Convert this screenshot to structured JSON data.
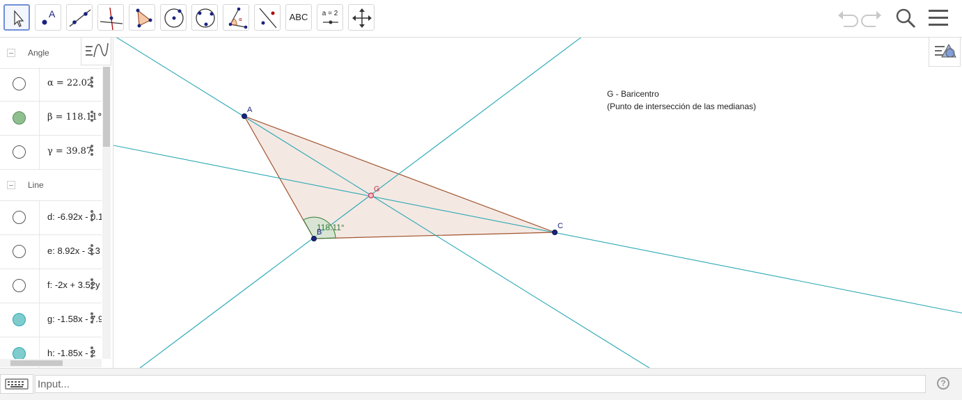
{
  "toolbar": {
    "text_tool_label": "ABC",
    "slider_tool_label": "a = 2"
  },
  "algebra": {
    "sections": [
      {
        "title": "Angle"
      },
      {
        "title": "Line"
      }
    ],
    "angle_items": [
      {
        "name": "α",
        "value": "= 22.02",
        "color": "#ffffff"
      },
      {
        "name": "β",
        "value": "= 118.11°",
        "color": "#8fbf8f"
      },
      {
        "name": "γ",
        "value": "= 39.87",
        "color": "#ffffff"
      }
    ],
    "line_items": [
      {
        "text": "d: -6.92x - 0.1",
        "color": "#ffffff"
      },
      {
        "text": "e: 8.92x - 3.3",
        "color": "#ffffff"
      },
      {
        "text": "f: -2x + 3.52y",
        "color": "#ffffff"
      },
      {
        "text": "g: -1.58x - 7.9",
        "color": "#7fcccc"
      },
      {
        "text": "h: -1.85x - 2",
        "color": "#7fcccc"
      }
    ]
  },
  "graphics": {
    "points": {
      "A": "A",
      "B": "B",
      "C": "C",
      "G": "G"
    },
    "angle_label": "118.11°",
    "note": "G - Baricentro\n(Punto de intersección de las medianas)",
    "colors": {
      "median": "#2aa8b4",
      "triangle": "#a0522d",
      "triangle_fill": "#f4e8e3",
      "point": "#1a237e",
      "centroid": "#cc3355"
    }
  },
  "input": {
    "placeholder": "Input..."
  }
}
